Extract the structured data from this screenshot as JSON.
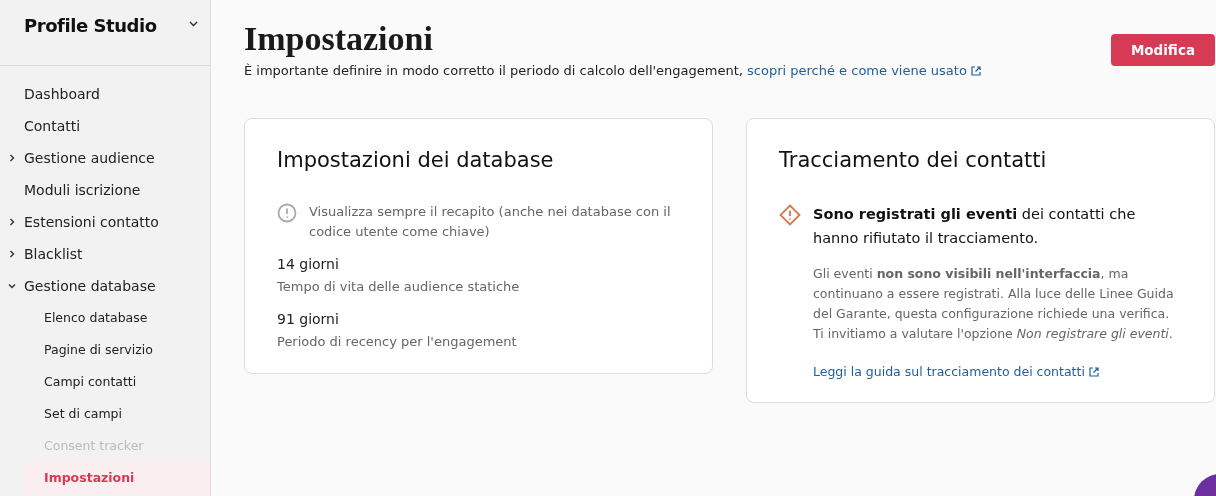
{
  "sidebar": {
    "title": "Profile Studio",
    "items": [
      {
        "kind": "link",
        "label": "Dashboard",
        "selected": false,
        "disabled": false
      },
      {
        "kind": "link",
        "label": "Contatti",
        "selected": false,
        "disabled": false
      },
      {
        "kind": "group",
        "label": "Gestione audience",
        "expanded": false
      },
      {
        "kind": "link",
        "label": "Moduli iscrizione",
        "selected": false,
        "disabled": false
      },
      {
        "kind": "group",
        "label": "Estensioni contatto",
        "expanded": false
      },
      {
        "kind": "group",
        "label": "Blacklist",
        "expanded": false
      },
      {
        "kind": "group",
        "label": "Gestione database",
        "expanded": true,
        "children": [
          {
            "kind": "link",
            "label": "Elenco database",
            "selected": false,
            "disabled": false
          },
          {
            "kind": "link",
            "label": "Pagine di servizio",
            "selected": false,
            "disabled": false
          },
          {
            "kind": "link",
            "label": "Campi contatti",
            "selected": false,
            "disabled": false
          },
          {
            "kind": "link",
            "label": "Set di campi",
            "selected": false,
            "disabled": false
          },
          {
            "kind": "link",
            "label": "Consent tracker",
            "selected": false,
            "disabled": true
          },
          {
            "kind": "link",
            "label": "Impostazioni",
            "selected": true,
            "disabled": false
          }
        ]
      }
    ]
  },
  "header": {
    "title": "Impostazioni",
    "subtitle": "È importante definire in modo corretto il periodo di calcolo dell'engagement,",
    "subtitle_link": "scopri perché e come viene usato",
    "button": "Modifica"
  },
  "database_card": {
    "title": "Impostazioni dei database",
    "notice": "Visualizza sempre il recapito (anche nei database con il codice utente come chiave)",
    "settings": [
      {
        "value": "14 giorni",
        "label": "Tempo di vita delle audience statiche"
      },
      {
        "value": "91 giorni",
        "label": "Periodo di recency per l'engagement"
      }
    ]
  },
  "tracking_card": {
    "title": "Tracciamento dei contatti",
    "warning": "**Sono registrati gli eventi** dei contatti che hanno rifiutato il tracciamento.",
    "details": [
      "Gli eventi **non sono visibili nell'interfaccia**, ma continuano a essere registrati. Alla luce delle Linee Guida del Garante, questa configurazione richiede una verifica.",
      "Ti invitiamo a valutare l'opzione *Non registrare gli eventi*."
    ],
    "link": "Leggi la guida sul tracciamento dei contatti"
  }
}
